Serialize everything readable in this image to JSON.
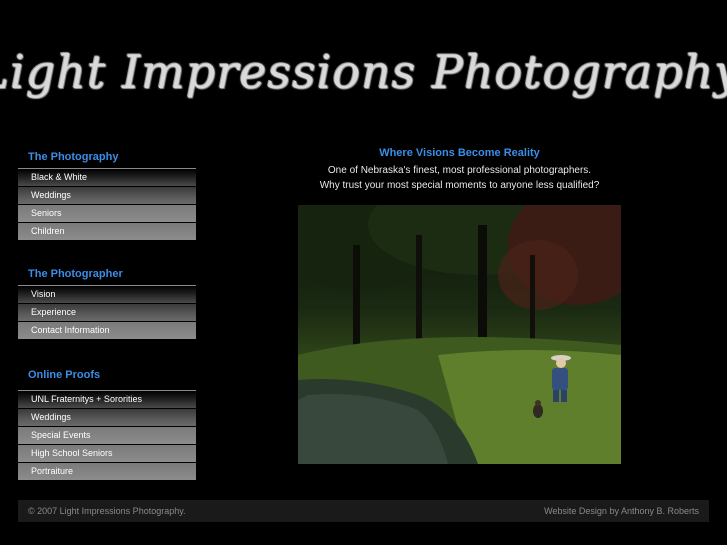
{
  "header": {
    "logo_text": "Light Impressions Photography"
  },
  "sidebar": {
    "sections": [
      {
        "title": "The Photography",
        "items": [
          "Black & White",
          "Weddings",
          "Seniors",
          "Children"
        ]
      },
      {
        "title": "The Photographer",
        "items": [
          "Vision",
          "Experience",
          "Contact Information"
        ]
      },
      {
        "title": "Online Proofs",
        "items": [
          "UNL Fraternitys + Sororities",
          "Weddings",
          "Special Events",
          "High School Seniors",
          "Portraiture"
        ]
      }
    ]
  },
  "main": {
    "tagline": "Where Visions Become Reality",
    "intro_line1": "One of Nebraska's finest, most professional photographers.",
    "intro_line2": "Why trust your most special moments to anyone less qualified?"
  },
  "footer": {
    "copyright": "© 2007 Light Impressions Photography.",
    "credit": "Website Design by Anthony  B. Roberts"
  },
  "colors": {
    "accent": "#3a8ee6",
    "background": "#000000"
  }
}
